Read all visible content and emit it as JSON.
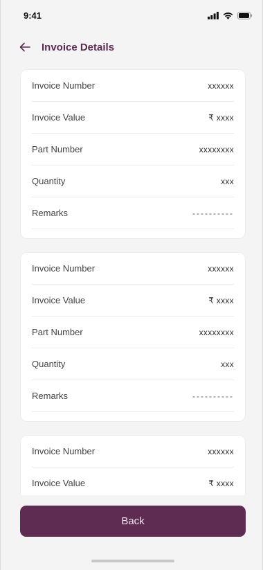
{
  "status_bar": {
    "time": "9:41"
  },
  "header": {
    "title": "Invoice Details"
  },
  "cards": [
    {
      "rows": [
        {
          "label": "Invoice Number",
          "value": "xxxxxx"
        },
        {
          "label": "Invoice Value",
          "value": "₹ xxxx"
        },
        {
          "label": "Part Number",
          "value": "xxxxxxxx"
        },
        {
          "label": "Quantity",
          "value": "xxx"
        },
        {
          "label": "Remarks",
          "value": "----------"
        }
      ]
    },
    {
      "rows": [
        {
          "label": "Invoice Number",
          "value": "xxxxxx"
        },
        {
          "label": "Invoice Value",
          "value": "₹ xxxx"
        },
        {
          "label": "Part Number",
          "value": "xxxxxxxx"
        },
        {
          "label": "Quantity",
          "value": "xxx"
        },
        {
          "label": "Remarks",
          "value": "----------"
        }
      ]
    },
    {
      "rows": [
        {
          "label": "Invoice Number",
          "value": "xxxxxx"
        },
        {
          "label": "Invoice Value",
          "value": "₹ xxxx"
        }
      ]
    }
  ],
  "footer": {
    "back_label": "Back"
  },
  "colors": {
    "primary": "#5e2b52",
    "title": "#5b2a52",
    "background": "#f4f4f4",
    "card": "#ffffff"
  },
  "icons": {
    "back": "arrow-left-icon",
    "signal": "signal-icon",
    "wifi": "wifi-icon",
    "battery": "battery-icon"
  }
}
